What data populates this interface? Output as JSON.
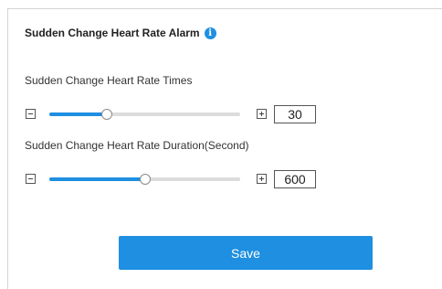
{
  "alarm": {
    "title": "Sudden Change Heart Rate Alarm",
    "info_icon": "i",
    "times": {
      "label": "Sudden Change Heart Rate Times",
      "value": "30",
      "slider_level": 0.3,
      "color": "#1e8fe1"
    },
    "duration": {
      "label": "Sudden Change Heart Rate Duration(Second)",
      "value": "600",
      "slider_level": 0.5,
      "color": "#1e8fe1"
    }
  },
  "actions": {
    "save_label": "Save"
  },
  "icons": {
    "info": "info-icon",
    "minus": "minus-icon",
    "plus": "plus-icon"
  }
}
